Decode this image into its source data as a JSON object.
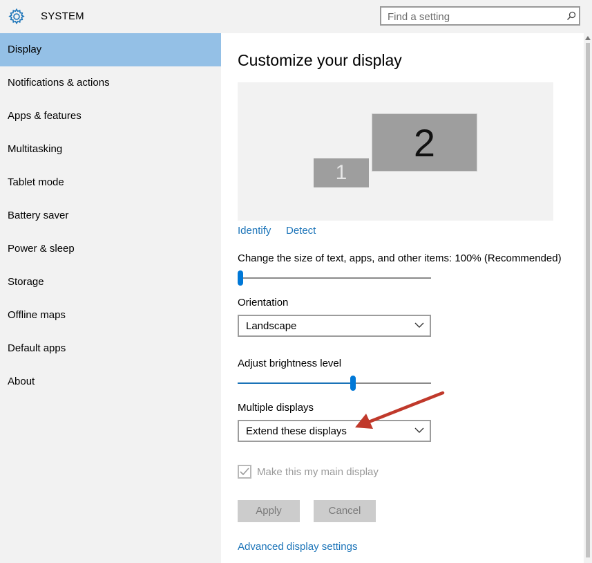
{
  "header": {
    "title": "SYSTEM",
    "icon": "gear-icon",
    "search_placeholder": "Find a setting"
  },
  "sidebar": {
    "items": [
      {
        "label": "Display",
        "selected": true
      },
      {
        "label": "Notifications & actions"
      },
      {
        "label": "Apps & features"
      },
      {
        "label": "Multitasking"
      },
      {
        "label": "Tablet mode"
      },
      {
        "label": "Battery saver"
      },
      {
        "label": "Power & sleep"
      },
      {
        "label": "Storage"
      },
      {
        "label": "Offline maps"
      },
      {
        "label": "Default apps"
      },
      {
        "label": "About"
      }
    ]
  },
  "main": {
    "title": "Customize your display",
    "monitors": [
      "1",
      "2"
    ],
    "identify_label": "Identify",
    "detect_label": "Detect",
    "scale_label": "Change the size of text, apps, and other items: 100% (Recommended)",
    "scale_level": 0.0,
    "orientation_label": "Orientation",
    "orientation_value": "Landscape",
    "brightness_label": "Adjust brightness level",
    "brightness_level": 0.6,
    "multiple_displays_label": "Multiple displays",
    "multiple_displays_value": "Extend these displays",
    "main_display_label": "Make this my main display",
    "main_display_checked": true,
    "apply_label": "Apply",
    "cancel_label": "Cancel",
    "advanced_link": "Advanced display settings"
  },
  "colors": {
    "accent": "#0078d7",
    "selected_nav": "#94c0e6",
    "annotation_arrow": "#c0392b"
  }
}
